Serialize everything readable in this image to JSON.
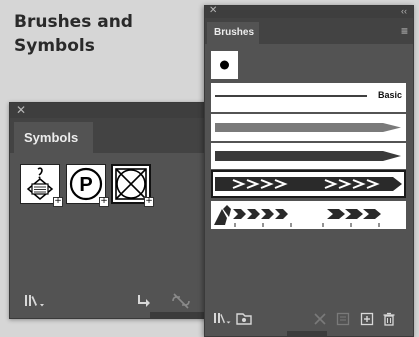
{
  "heading": {
    "line1": "Brushes and",
    "line2": "Symbols"
  },
  "symbols_panel": {
    "close_glyph": "✕",
    "tab_label": "Symbols",
    "symbols": [
      {
        "icon": "tag-symbol-icon",
        "plus": "+"
      },
      {
        "icon": "parking-symbol-icon",
        "letter": "P",
        "plus": "+"
      },
      {
        "icon": "crossed-box-symbol-icon",
        "plus": "+",
        "selected": true
      }
    ],
    "bottom_icons": [
      "symbol-libraries-menu-icon",
      "place-symbol-instance-icon",
      "break-link-icon"
    ]
  },
  "brushes_panel": {
    "close_glyph": "✕",
    "collapse_glyph": "‹‹",
    "tab_label": "Brushes",
    "menu_glyph": "≡",
    "brushes": [
      {
        "name": "dot-brush"
      },
      {
        "name": "basic-brush",
        "label": "Basic"
      },
      {
        "name": "tapered-gray-brush"
      },
      {
        "name": "tapered-dark-brush"
      },
      {
        "name": "chevron-brush",
        "selected": true
      },
      {
        "name": "pattern-chevron-brush"
      }
    ],
    "bottom_icons": [
      "brush-libraries-menu-icon",
      "libraries-panel-icon",
      "remove-brush-stroke-icon",
      "brush-options-icon",
      "new-brush-icon",
      "delete-brush-icon"
    ]
  }
}
